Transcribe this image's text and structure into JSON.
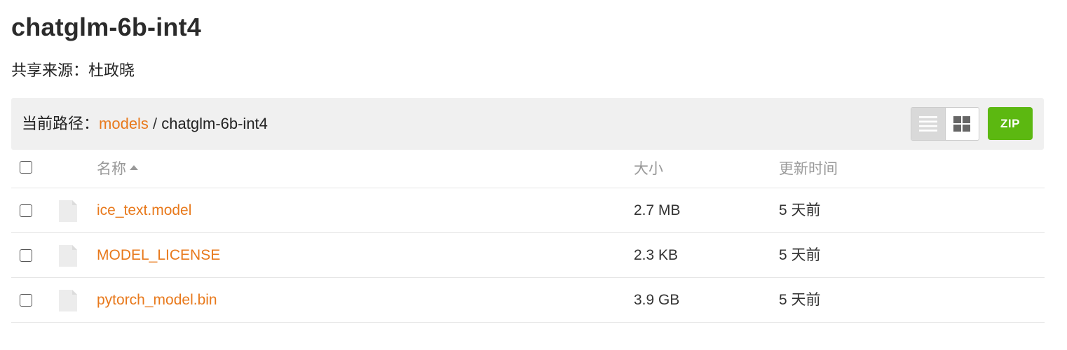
{
  "page": {
    "title": "chatglm-6b-int4",
    "share_source": "共享来源：杜政晓"
  },
  "pathbar": {
    "label": "当前路径：",
    "root_link": "models",
    "separator": " / ",
    "current": "chatglm-6b-int4",
    "zip_label": "ZIP"
  },
  "table": {
    "headers": {
      "name": "名称",
      "size": "大小",
      "modified": "更新时间"
    },
    "rows": [
      {
        "name": "ice_text.model",
        "size": "2.7 MB",
        "modified": "5 天前"
      },
      {
        "name": "MODEL_LICENSE",
        "size": "2.3 KB",
        "modified": "5 天前"
      },
      {
        "name": "pytorch_model.bin",
        "size": "3.9 GB",
        "modified": "5 天前"
      }
    ]
  },
  "icons": {
    "list_view": "list-view-icon",
    "grid_view": "grid-view-icon",
    "file": "file-icon",
    "sort": "sort-ascending-icon"
  },
  "colors": {
    "link": "#e8791c",
    "zip_button": "#5cb811",
    "pathbar_bg": "#f0f0f0",
    "header_text": "#999999"
  }
}
